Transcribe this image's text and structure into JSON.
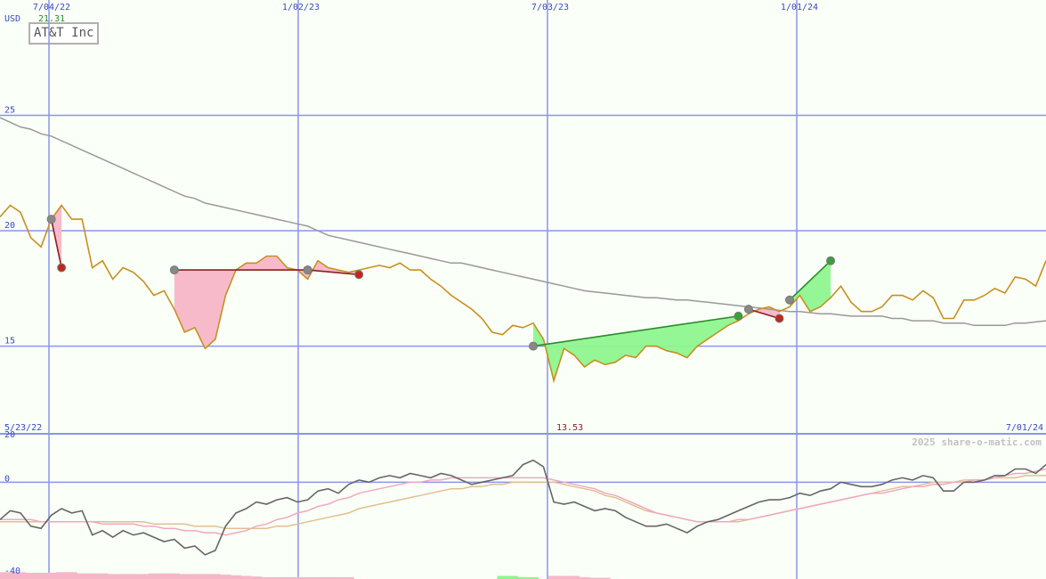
{
  "title": "AT&T Inc",
  "currency": "USD",
  "copyright": "2025 share-o-matic.com",
  "last_close": "21.31",
  "low_value": "13.53",
  "colors": {
    "background": "#fafff8",
    "grid": "#8a96e8",
    "price": "#c8901e",
    "moving_average": "#999999",
    "up_fill": "#8ff58f",
    "down_fill": "#f7b6c8",
    "up_trend": "#2a8c2a",
    "down_trend": "#8c1e1e",
    "oscillator": "#666666",
    "signal_pink": "#f0a8c0",
    "signal_tan": "#e0c090",
    "last_close": "#2a8c2a",
    "low_label": "#8c1e1e"
  },
  "chart_data": [
    {
      "type": "line",
      "name": "price",
      "xlabel": "",
      "ylabel": "USD",
      "x_tick_labels": [
        "7/04/22",
        "1/02/23",
        "7/03/23",
        "1/01/24"
      ],
      "x_range_labels": [
        "5/23/22",
        "7/01/24"
      ],
      "y_ticks": [
        15,
        20,
        25
      ],
      "ylim": [
        11.2,
        30.0
      ],
      "grid": true,
      "series": [
        {
          "values": [
            20.6,
            21.1,
            20.8,
            19.7,
            19.3,
            20.5,
            21.1,
            20.5,
            20.5,
            18.4,
            18.7,
            17.9,
            18.4,
            18.2,
            17.8,
            17.2,
            17.4,
            16.6,
            15.6,
            15.8,
            14.9,
            15.3,
            17.2,
            18.3,
            18.6,
            18.6,
            18.9,
            18.9,
            18.4,
            18.3,
            17.9,
            18.7,
            18.4,
            18.3,
            18.2,
            18.3,
            18.4,
            18.5,
            18.4,
            18.6,
            18.3,
            18.3,
            17.9,
            17.6,
            17.2,
            16.9,
            16.6,
            16.2,
            15.6,
            15.5,
            15.9,
            15.8,
            16.0,
            15.3,
            13.5,
            14.9,
            14.6,
            14.1,
            14.4,
            14.2,
            14.3,
            14.6,
            14.5,
            15.0,
            15.0,
            14.8,
            14.7,
            14.5,
            15.0,
            15.3,
            15.6,
            15.9,
            16.1,
            16.4,
            16.6,
            16.7,
            16.5,
            16.7,
            17.2,
            16.5,
            16.7,
            17.1,
            17.6,
            16.9,
            16.5,
            16.5,
            16.7,
            17.2,
            17.2,
            17.0,
            17.4,
            17.1,
            16.2,
            16.2,
            17.0,
            17.0,
            17.2,
            17.5,
            17.3,
            18.0,
            17.9,
            17.6,
            18.7
          ]
        },
        {
          "values": [
            24.9,
            24.7,
            24.5,
            24.4,
            24.2,
            24.1,
            23.9,
            23.7,
            23.5,
            23.3,
            23.1,
            22.9,
            22.7,
            22.5,
            22.3,
            22.1,
            21.9,
            21.7,
            21.5,
            21.4,
            21.2,
            21.1,
            21.0,
            20.9,
            20.8,
            20.7,
            20.6,
            20.5,
            20.4,
            20.3,
            20.2,
            20.0,
            19.8,
            19.7,
            19.6,
            19.5,
            19.4,
            19.3,
            19.2,
            19.1,
            19.0,
            18.9,
            18.8,
            18.7,
            18.6,
            18.6,
            18.5,
            18.4,
            18.3,
            18.2,
            18.1,
            18.0,
            17.9,
            17.8,
            17.7,
            17.6,
            17.5,
            17.4,
            17.35,
            17.3,
            17.25,
            17.2,
            17.15,
            17.1,
            17.1,
            17.05,
            17.0,
            17.0,
            16.95,
            16.9,
            16.85,
            16.8,
            16.75,
            16.7,
            16.65,
            16.6,
            16.55,
            16.5,
            16.5,
            16.45,
            16.4,
            16.4,
            16.35,
            16.3,
            16.3,
            16.3,
            16.3,
            16.2,
            16.2,
            16.1,
            16.1,
            16.1,
            16.0,
            16.0,
            16.0,
            15.9,
            15.9,
            15.9,
            15.9,
            16.0,
            16.0,
            16.05,
            16.1
          ]
        }
      ],
      "trend_lines": [
        {
          "trend": "down",
          "from": [
            5,
            20.5
          ],
          "to": [
            6,
            18.4
          ]
        },
        {
          "trend": "down",
          "from": [
            17,
            18.3
          ],
          "to": [
            30,
            18.3
          ]
        },
        {
          "trend": "down",
          "from": [
            30,
            18.3
          ],
          "to": [
            35,
            18.1
          ]
        },
        {
          "trend": "up",
          "from": [
            52,
            15.0
          ],
          "to": [
            72,
            16.3
          ]
        },
        {
          "trend": "down",
          "from": [
            73,
            16.6
          ],
          "to": [
            76,
            16.2
          ]
        },
        {
          "trend": "up",
          "from": [
            77,
            17.0
          ],
          "to": [
            81,
            18.7
          ]
        }
      ]
    },
    {
      "type": "line",
      "name": "oscillator",
      "xlabel": "",
      "ylabel": "",
      "y_ticks": [
        -40,
        0,
        20
      ],
      "ylim": [
        -44,
        22
      ],
      "grid": true,
      "series": [
        {
          "values": [
            -17,
            -13,
            -14,
            -20,
            -21,
            -15,
            -12,
            -14,
            -13,
            -24,
            -22,
            -25,
            -22,
            -24,
            -23,
            -25,
            -27,
            -26,
            -30,
            -29,
            -33,
            -31,
            -20,
            -14,
            -12,
            -9,
            -10,
            -8,
            -7,
            -9,
            -8,
            -4,
            -3,
            -5,
            -1,
            1,
            0,
            2,
            3,
            2,
            4,
            3,
            2,
            4,
            3,
            1,
            -1,
            0,
            1,
            2,
            3,
            8,
            10,
            7,
            -9,
            -10,
            -9,
            -11,
            -13,
            -12,
            -13,
            -16,
            -18,
            -20,
            -20,
            -19,
            -21,
            -23,
            -20,
            -18,
            -17,
            -15,
            -13,
            -11,
            -9,
            -8,
            -8,
            -7,
            -5,
            -6,
            -4,
            -3,
            0,
            -1,
            -2,
            -2,
            -1,
            1,
            2,
            1,
            3,
            2,
            -4,
            -4,
            0,
            0,
            1,
            3,
            3,
            6,
            6,
            4,
            8
          ]
        },
        {
          "values": [
            -17,
            -17,
            -17,
            -17,
            -18,
            -18,
            -18,
            -18,
            -18,
            -18,
            -19,
            -19,
            -19,
            -19,
            -20,
            -20,
            -21,
            -21,
            -22,
            -22,
            -23,
            -23,
            -24,
            -23,
            -22,
            -20,
            -19,
            -17,
            -16,
            -14,
            -13,
            -11,
            -10,
            -8,
            -7,
            -5,
            -4,
            -3,
            -2,
            -1,
            0,
            0,
            1,
            1,
            2,
            2,
            2,
            2,
            2,
            2,
            2,
            2,
            2,
            2,
            1,
            0,
            -1,
            -2,
            -3,
            -5,
            -6,
            -8,
            -10,
            -12,
            -14,
            -15,
            -16,
            -17,
            -18,
            -18,
            -18,
            -18,
            -17,
            -17,
            -16,
            -15,
            -14,
            -13,
            -12,
            -11,
            -10,
            -9,
            -8,
            -7,
            -6,
            -5,
            -5,
            -4,
            -3,
            -2,
            -2,
            -1,
            -1,
            0,
            0,
            1,
            1,
            2,
            3,
            4,
            4,
            5,
            6
          ]
        },
        {
          "values": [
            -18,
            -18,
            -18,
            -18,
            -18,
            -18,
            -18,
            -18,
            -18,
            -18,
            -18,
            -18,
            -18,
            -18,
            -18,
            -19,
            -19,
            -19,
            -19,
            -20,
            -20,
            -20,
            -21,
            -21,
            -21,
            -21,
            -21,
            -20,
            -20,
            -19,
            -18,
            -17,
            -16,
            -15,
            -14,
            -12,
            -11,
            -10,
            -9,
            -8,
            -7,
            -6,
            -5,
            -4,
            -3,
            -3,
            -2,
            -2,
            -1,
            -1,
            0,
            0,
            0,
            0,
            0,
            -1,
            -2,
            -3,
            -4,
            -6,
            -7,
            -9,
            -11,
            -13,
            -14,
            -15,
            -16,
            -17,
            -18,
            -18,
            -18,
            -18,
            -18,
            -17,
            -16,
            -15,
            -14,
            -13,
            -12,
            -11,
            -10,
            -9,
            -8,
            -7,
            -6,
            -5,
            -4,
            -3,
            -2,
            -2,
            -1,
            0,
            0,
            0,
            1,
            1,
            1,
            2,
            2,
            2,
            3,
            3,
            3
          ]
        }
      ],
      "histogram": [
        -1,
        -1,
        -1,
        -1,
        -1,
        -1,
        -1,
        -1,
        -1,
        -1,
        -1,
        -1,
        -1,
        -1,
        -1,
        -1,
        -1,
        -1,
        -1,
        -1,
        -1,
        -1,
        -1,
        -1,
        -1,
        -1,
        -1,
        -1,
        -1,
        -1,
        -1,
        -1,
        -1,
        -1,
        -1,
        0,
        0,
        0,
        0,
        0,
        0,
        0,
        0,
        0,
        0,
        0,
        0,
        0,
        0,
        0,
        0,
        0,
        0,
        0,
        0,
        -1,
        -1,
        -1,
        -1,
        -1,
        0,
        0,
        0,
        0,
        0,
        0,
        0,
        0,
        0,
        0,
        0,
        0,
        0,
        0,
        0,
        0,
        0,
        0,
        0,
        0,
        0,
        0,
        0,
        0,
        0,
        0,
        0,
        0,
        0,
        0,
        0,
        0,
        0,
        0,
        0,
        0,
        0,
        0,
        0,
        0,
        0,
        0,
        0
      ],
      "histogram_values": [
        -5.5,
        -5.5,
        -5.5,
        -5,
        -5,
        -5,
        -5.5,
        -5.5,
        -4.5,
        -4.5,
        -4.5,
        -4,
        -4,
        -4,
        -4,
        -4.5,
        -4.5,
        -4.5,
        -4,
        -4,
        -4,
        -4,
        -3.5,
        -3,
        -2.5,
        -2,
        -1.5,
        -1.5,
        -1.5,
        -1.5,
        -1.5,
        -1.5,
        -1.5,
        -1.5,
        -1.5,
        0,
        0,
        0,
        0,
        0,
        0,
        0,
        0,
        0,
        0,
        0,
        0,
        0,
        0,
        2.5,
        2.5,
        1.5,
        1.5,
        0,
        -2.5,
        -2.5,
        -2.5,
        -1.5,
        -1,
        -1,
        0,
        0,
        0,
        0,
        0,
        0,
        0,
        0,
        0,
        0,
        0,
        0,
        0,
        0,
        0,
        0,
        0,
        0,
        0,
        0,
        0,
        0,
        0,
        0,
        0,
        0,
        0,
        0,
        0,
        0,
        0,
        0,
        0,
        0,
        0,
        0,
        0,
        0,
        0,
        0,
        0
      ]
    }
  ]
}
